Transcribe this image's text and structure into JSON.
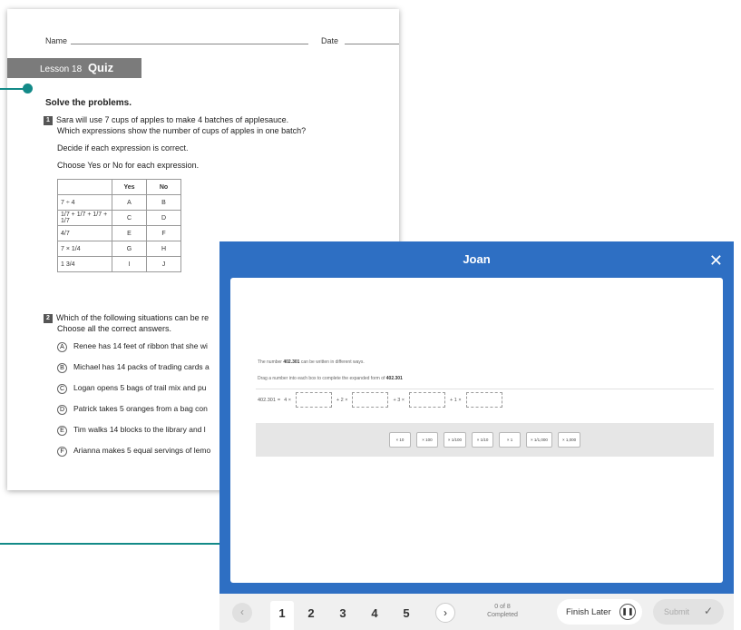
{
  "worksheet": {
    "name_label": "Name",
    "date_label": "Date",
    "lesson_label": "Lesson 18",
    "quiz_label": "Quiz",
    "section_title": "Solve the problems.",
    "q1_number": "1",
    "q1_text_line1": "Sara will use 7 cups of apples to make 4 batches of applesauce.",
    "q1_text_line2": "Which expressions show the number of cups of apples in one batch?",
    "q1_instruction1": "Decide if each expression is correct.",
    "q1_instruction2": "Choose Yes or No for each expression.",
    "table_headers": [
      "",
      "Yes",
      "No"
    ],
    "table_rows": [
      {
        "expr": "7 ÷ 4",
        "yes": "A",
        "no": "B"
      },
      {
        "expr": "1/7 + 1/7 + 1/7 + 1/7",
        "yes": "C",
        "no": "D"
      },
      {
        "expr": "4/7",
        "yes": "E",
        "no": "F"
      },
      {
        "expr": "7 × 1/4",
        "yes": "G",
        "no": "H"
      },
      {
        "expr": "1 3/4",
        "yes": "I",
        "no": "J"
      }
    ],
    "q2_number": "2",
    "q2_text_line1": "Which of the following situations can be re",
    "q2_text_line2": "Choose all the correct answers.",
    "q2_choices": [
      {
        "letter": "A",
        "text": "Renee has 14 feet of ribbon that she wi"
      },
      {
        "letter": "B",
        "text": "Michael has 14 packs of trading cards a"
      },
      {
        "letter": "C",
        "text": "Logan opens 5 bags of trail mix and pu"
      },
      {
        "letter": "D",
        "text": "Patrick takes 5 oranges from a bag con"
      },
      {
        "letter": "E",
        "text": "Tim walks 14 blocks to the library and l"
      },
      {
        "letter": "F",
        "text": "Arianna makes 5 equal servings of lemo"
      }
    ]
  },
  "app": {
    "title": "Joan",
    "close_icon": "close-icon",
    "prompt_line1_pre": "The number ",
    "prompt_number": "402.301",
    "prompt_line1_post": " can be written in different ways.",
    "prompt_line2_pre": "Drag a number into each box to complete the expanded form of ",
    "prompt_line2_number": "402.301",
    "expansion_start": "402.301",
    "expansion_parts": [
      "=",
      "4 ×",
      "+ 2 ×",
      "+ 3 ×",
      "+ 1 ×"
    ],
    "chips": [
      "× 10",
      "× 100",
      "× 1/100",
      "× 1/10",
      "× 1",
      "× 1/1,000",
      "× 1,000"
    ],
    "footer": {
      "prev_icon": "chevron-left-icon",
      "next_icon": "chevron-right-icon",
      "pages": [
        "1",
        "2",
        "3",
        "4",
        "5"
      ],
      "active_page": "1",
      "progress_line1": "0 of 8",
      "progress_line2": "Completed",
      "finish_label": "Finish Later",
      "submit_label": "Submit"
    }
  },
  "colors": {
    "app_blue": "#2e6fc3",
    "callout_teal": "#138a88",
    "banner_gray": "#7b7b7b"
  }
}
